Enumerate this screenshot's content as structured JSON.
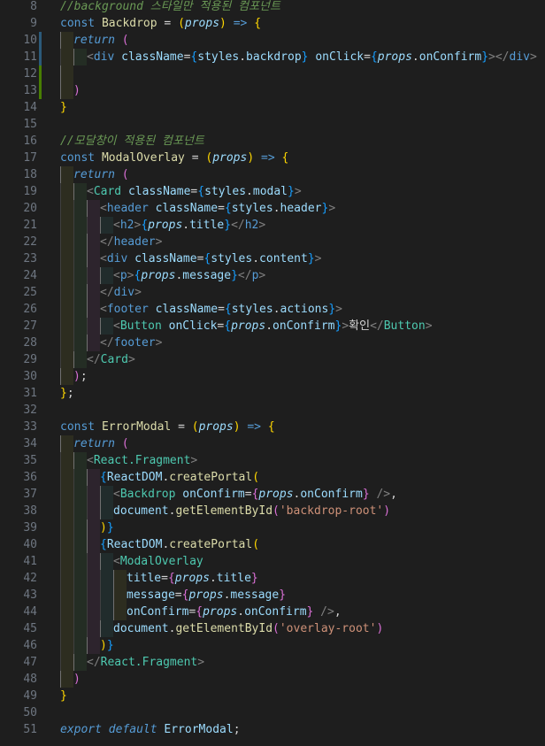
{
  "editor": {
    "language": "javascript-jsx",
    "theme_colors": {
      "background": "#1e1e1e",
      "line_number": "#6e7681",
      "keyword": "#569cd6",
      "identifier": "#9cdcfe",
      "function": "#dcdcaa",
      "type": "#4ec9b0",
      "string": "#ce9178",
      "comment": "#6a9955",
      "bracket_yellow": "#ffd700",
      "bracket_magenta": "#da70d6",
      "bracket_blue": "#179fff",
      "gutter_modified": "#2b5a7a",
      "gutter_added": "#487e02"
    },
    "lines": [
      {
        "n": "8",
        "indent": 0,
        "mark": "",
        "tokens": [
          [
            "com",
            "//background 스타일만 적용된 컴포넌트"
          ]
        ]
      },
      {
        "n": "9",
        "indent": 0,
        "mark": "",
        "tokens": [
          [
            "kw",
            "const "
          ],
          [
            "fn",
            "Backdrop"
          ],
          [
            "plain",
            " = "
          ],
          [
            "br1",
            "("
          ],
          [
            "id-i",
            "props"
          ],
          [
            "br1",
            ")"
          ],
          [
            "kw",
            " => "
          ],
          [
            "br1",
            "{"
          ]
        ]
      },
      {
        "n": "10",
        "indent": 1,
        "mark": "modified",
        "tokens": [
          [
            "kwi",
            "return "
          ],
          [
            "br2",
            "("
          ]
        ]
      },
      {
        "n": "11",
        "indent": 2,
        "mark": "modified",
        "tokens": [
          [
            "tagp",
            "<"
          ],
          [
            "tag",
            "div "
          ],
          [
            "attr",
            "className"
          ],
          [
            "punc",
            "="
          ],
          [
            "br3",
            "{"
          ],
          [
            "id",
            "styles"
          ],
          [
            "punc",
            "."
          ],
          [
            "id",
            "backdrop"
          ],
          [
            "br3",
            "}"
          ],
          [
            "attr",
            " onClick"
          ],
          [
            "punc",
            "="
          ],
          [
            "br3",
            "{"
          ],
          [
            "id-i",
            "props"
          ],
          [
            "punc",
            "."
          ],
          [
            "id",
            "onConfirm"
          ],
          [
            "br3",
            "}"
          ],
          [
            "tagp",
            "></"
          ],
          [
            "tag",
            "div"
          ],
          [
            "tagp",
            ">"
          ]
        ]
      },
      {
        "n": "12",
        "indent": 1,
        "mark": "added",
        "tokens": []
      },
      {
        "n": "13",
        "indent": 1,
        "mark": "added",
        "tokens": [
          [
            "br2",
            ")"
          ]
        ]
      },
      {
        "n": "14",
        "indent": 0,
        "mark": "",
        "tokens": [
          [
            "br1",
            "}"
          ]
        ]
      },
      {
        "n": "15",
        "indent": 0,
        "mark": "",
        "tokens": []
      },
      {
        "n": "16",
        "indent": 0,
        "mark": "",
        "tokens": [
          [
            "com",
            "//모달창이 적용된 컴포넌트"
          ]
        ]
      },
      {
        "n": "17",
        "indent": 0,
        "mark": "",
        "tokens": [
          [
            "kw",
            "const "
          ],
          [
            "fn",
            "ModalOverlay"
          ],
          [
            "plain",
            " = "
          ],
          [
            "br1",
            "("
          ],
          [
            "id-i",
            "props"
          ],
          [
            "br1",
            ")"
          ],
          [
            "kw",
            " => "
          ],
          [
            "br1",
            "{"
          ]
        ]
      },
      {
        "n": "18",
        "indent": 1,
        "mark": "",
        "tokens": [
          [
            "kwi",
            "return "
          ],
          [
            "br2",
            "("
          ]
        ]
      },
      {
        "n": "19",
        "indent": 2,
        "mark": "",
        "tokens": [
          [
            "tagp",
            "<"
          ],
          [
            "type",
            "Card "
          ],
          [
            "attr",
            "className"
          ],
          [
            "punc",
            "="
          ],
          [
            "br3",
            "{"
          ],
          [
            "id",
            "styles"
          ],
          [
            "punc",
            "."
          ],
          [
            "id",
            "modal"
          ],
          [
            "br3",
            "}"
          ],
          [
            "tagp",
            ">"
          ]
        ]
      },
      {
        "n": "20",
        "indent": 3,
        "mark": "",
        "tokens": [
          [
            "tagp",
            "<"
          ],
          [
            "tag",
            "header "
          ],
          [
            "attr",
            "className"
          ],
          [
            "punc",
            "="
          ],
          [
            "br3",
            "{"
          ],
          [
            "id",
            "styles"
          ],
          [
            "punc",
            "."
          ],
          [
            "id",
            "header"
          ],
          [
            "br3",
            "}"
          ],
          [
            "tagp",
            ">"
          ]
        ]
      },
      {
        "n": "21",
        "indent": 4,
        "mark": "",
        "tokens": [
          [
            "tagp",
            "<"
          ],
          [
            "tag",
            "h2"
          ],
          [
            "tagp",
            ">"
          ],
          [
            "br3",
            "{"
          ],
          [
            "id-i",
            "props"
          ],
          [
            "punc",
            "."
          ],
          [
            "id",
            "title"
          ],
          [
            "br3",
            "}"
          ],
          [
            "tagp",
            "</"
          ],
          [
            "tag",
            "h2"
          ],
          [
            "tagp",
            ">"
          ]
        ]
      },
      {
        "n": "22",
        "indent": 3,
        "mark": "",
        "tokens": [
          [
            "tagp",
            "</"
          ],
          [
            "tag",
            "header"
          ],
          [
            "tagp",
            ">"
          ]
        ]
      },
      {
        "n": "23",
        "indent": 3,
        "mark": "",
        "tokens": [
          [
            "tagp",
            "<"
          ],
          [
            "tag",
            "div "
          ],
          [
            "attr",
            "className"
          ],
          [
            "punc",
            "="
          ],
          [
            "br3",
            "{"
          ],
          [
            "id",
            "styles"
          ],
          [
            "punc",
            "."
          ],
          [
            "id",
            "content"
          ],
          [
            "br3",
            "}"
          ],
          [
            "tagp",
            ">"
          ]
        ]
      },
      {
        "n": "24",
        "indent": 4,
        "mark": "",
        "tokens": [
          [
            "tagp",
            "<"
          ],
          [
            "tag",
            "p"
          ],
          [
            "tagp",
            ">"
          ],
          [
            "br3",
            "{"
          ],
          [
            "id-i",
            "props"
          ],
          [
            "punc",
            "."
          ],
          [
            "id",
            "message"
          ],
          [
            "br3",
            "}"
          ],
          [
            "tagp",
            "</"
          ],
          [
            "tag",
            "p"
          ],
          [
            "tagp",
            ">"
          ]
        ]
      },
      {
        "n": "25",
        "indent": 3,
        "mark": "",
        "tokens": [
          [
            "tagp",
            "</"
          ],
          [
            "tag",
            "div"
          ],
          [
            "tagp",
            ">"
          ]
        ]
      },
      {
        "n": "26",
        "indent": 3,
        "mark": "",
        "tokens": [
          [
            "tagp",
            "<"
          ],
          [
            "tag",
            "footer "
          ],
          [
            "attr",
            "className"
          ],
          [
            "punc",
            "="
          ],
          [
            "br3",
            "{"
          ],
          [
            "id",
            "styles"
          ],
          [
            "punc",
            "."
          ],
          [
            "id",
            "actions"
          ],
          [
            "br3",
            "}"
          ],
          [
            "tagp",
            ">"
          ]
        ]
      },
      {
        "n": "27",
        "indent": 4,
        "mark": "",
        "tokens": [
          [
            "tagp",
            "<"
          ],
          [
            "type",
            "Button "
          ],
          [
            "attr",
            "onClick"
          ],
          [
            "punc",
            "="
          ],
          [
            "br3",
            "{"
          ],
          [
            "id-i",
            "props"
          ],
          [
            "punc",
            "."
          ],
          [
            "id",
            "onConfirm"
          ],
          [
            "br3",
            "}"
          ],
          [
            "tagp",
            ">"
          ],
          [
            "plain",
            "확인"
          ],
          [
            "tagp",
            "</"
          ],
          [
            "type",
            "Button"
          ],
          [
            "tagp",
            ">"
          ]
        ]
      },
      {
        "n": "28",
        "indent": 3,
        "mark": "",
        "tokens": [
          [
            "tagp",
            "</"
          ],
          [
            "tag",
            "footer"
          ],
          [
            "tagp",
            ">"
          ]
        ]
      },
      {
        "n": "29",
        "indent": 2,
        "mark": "",
        "tokens": [
          [
            "tagp",
            "</"
          ],
          [
            "type",
            "Card"
          ],
          [
            "tagp",
            ">"
          ]
        ]
      },
      {
        "n": "30",
        "indent": 1,
        "mark": "",
        "tokens": [
          [
            "br2",
            ")"
          ],
          [
            "punc",
            ";"
          ]
        ]
      },
      {
        "n": "31",
        "indent": 0,
        "mark": "",
        "tokens": [
          [
            "br1",
            "}"
          ],
          [
            "punc",
            ";"
          ]
        ]
      },
      {
        "n": "32",
        "indent": 0,
        "mark": "",
        "tokens": []
      },
      {
        "n": "33",
        "indent": 0,
        "mark": "",
        "tokens": [
          [
            "kw",
            "const "
          ],
          [
            "fn",
            "ErrorModal"
          ],
          [
            "plain",
            " = "
          ],
          [
            "br1",
            "("
          ],
          [
            "id-i",
            "props"
          ],
          [
            "br1",
            ")"
          ],
          [
            "kw",
            " => "
          ],
          [
            "br1",
            "{"
          ]
        ]
      },
      {
        "n": "34",
        "indent": 1,
        "mark": "",
        "tokens": [
          [
            "kwi",
            "return "
          ],
          [
            "br2",
            "("
          ]
        ]
      },
      {
        "n": "35",
        "indent": 2,
        "mark": "",
        "tokens": [
          [
            "tagp",
            "<"
          ],
          [
            "type",
            "React.Fragment"
          ],
          [
            "tagp",
            ">"
          ]
        ]
      },
      {
        "n": "36",
        "indent": 3,
        "mark": "",
        "tokens": [
          [
            "br3",
            "{"
          ],
          [
            "id",
            "ReactDOM"
          ],
          [
            "punc",
            "."
          ],
          [
            "fn",
            "createPortal"
          ],
          [
            "br1",
            "("
          ]
        ]
      },
      {
        "n": "37",
        "indent": 4,
        "mark": "",
        "tokens": [
          [
            "tagp",
            "<"
          ],
          [
            "type",
            "Backdrop "
          ],
          [
            "attr",
            "onConfirm"
          ],
          [
            "punc",
            "="
          ],
          [
            "br2",
            "{"
          ],
          [
            "id-i",
            "props"
          ],
          [
            "punc",
            "."
          ],
          [
            "id",
            "onConfirm"
          ],
          [
            "br2",
            "}"
          ],
          [
            "tagp",
            " />"
          ],
          [
            "punc",
            ","
          ]
        ]
      },
      {
        "n": "38",
        "indent": 4,
        "mark": "",
        "tokens": [
          [
            "id",
            "document"
          ],
          [
            "punc",
            "."
          ],
          [
            "fn",
            "getElementById"
          ],
          [
            "br2",
            "("
          ],
          [
            "str",
            "'backdrop-root'"
          ],
          [
            "br2",
            ")"
          ]
        ]
      },
      {
        "n": "39",
        "indent": 3,
        "mark": "",
        "tokens": [
          [
            "br1",
            ")"
          ],
          [
            "br3",
            "}"
          ]
        ]
      },
      {
        "n": "40",
        "indent": 3,
        "mark": "",
        "tokens": [
          [
            "br3",
            "{"
          ],
          [
            "id",
            "ReactDOM"
          ],
          [
            "punc",
            "."
          ],
          [
            "fn",
            "createPortal"
          ],
          [
            "br1",
            "("
          ]
        ]
      },
      {
        "n": "41",
        "indent": 4,
        "mark": "",
        "tokens": [
          [
            "tagp",
            "<"
          ],
          [
            "type",
            "ModalOverlay"
          ]
        ]
      },
      {
        "n": "42",
        "indent": 5,
        "mark": "",
        "tokens": [
          [
            "attr",
            "title"
          ],
          [
            "punc",
            "="
          ],
          [
            "br2",
            "{"
          ],
          [
            "id-i",
            "props"
          ],
          [
            "punc",
            "."
          ],
          [
            "id",
            "title"
          ],
          [
            "br2",
            "}"
          ]
        ]
      },
      {
        "n": "43",
        "indent": 5,
        "mark": "",
        "tokens": [
          [
            "attr",
            "message"
          ],
          [
            "punc",
            "="
          ],
          [
            "br2",
            "{"
          ],
          [
            "id-i",
            "props"
          ],
          [
            "punc",
            "."
          ],
          [
            "id",
            "message"
          ],
          [
            "br2",
            "}"
          ]
        ]
      },
      {
        "n": "44",
        "indent": 5,
        "mark": "",
        "tokens": [
          [
            "attr",
            "onConfirm"
          ],
          [
            "punc",
            "="
          ],
          [
            "br2",
            "{"
          ],
          [
            "id-i",
            "props"
          ],
          [
            "punc",
            "."
          ],
          [
            "id",
            "onConfirm"
          ],
          [
            "br2",
            "}"
          ],
          [
            "tagp",
            " />"
          ],
          [
            "punc",
            ","
          ]
        ]
      },
      {
        "n": "45",
        "indent": 4,
        "mark": "",
        "tokens": [
          [
            "id",
            "document"
          ],
          [
            "punc",
            "."
          ],
          [
            "fn",
            "getElementById"
          ],
          [
            "br2",
            "("
          ],
          [
            "str",
            "'overlay-root'"
          ],
          [
            "br2",
            ")"
          ]
        ]
      },
      {
        "n": "46",
        "indent": 3,
        "mark": "",
        "tokens": [
          [
            "br1",
            ")"
          ],
          [
            "br3",
            "}"
          ]
        ]
      },
      {
        "n": "47",
        "indent": 2,
        "mark": "",
        "tokens": [
          [
            "tagp",
            "</"
          ],
          [
            "type",
            "React.Fragment"
          ],
          [
            "tagp",
            ">"
          ]
        ]
      },
      {
        "n": "48",
        "indent": 1,
        "mark": "",
        "tokens": [
          [
            "br2",
            ")"
          ]
        ]
      },
      {
        "n": "49",
        "indent": 0,
        "mark": "",
        "tokens": [
          [
            "br1",
            "}"
          ]
        ]
      },
      {
        "n": "50",
        "indent": 0,
        "mark": "",
        "tokens": []
      },
      {
        "n": "51",
        "indent": 0,
        "mark": "",
        "tokens": [
          [
            "kwi",
            "export default "
          ],
          [
            "id",
            "ErrorModal"
          ],
          [
            "punc",
            ";"
          ]
        ]
      }
    ]
  }
}
